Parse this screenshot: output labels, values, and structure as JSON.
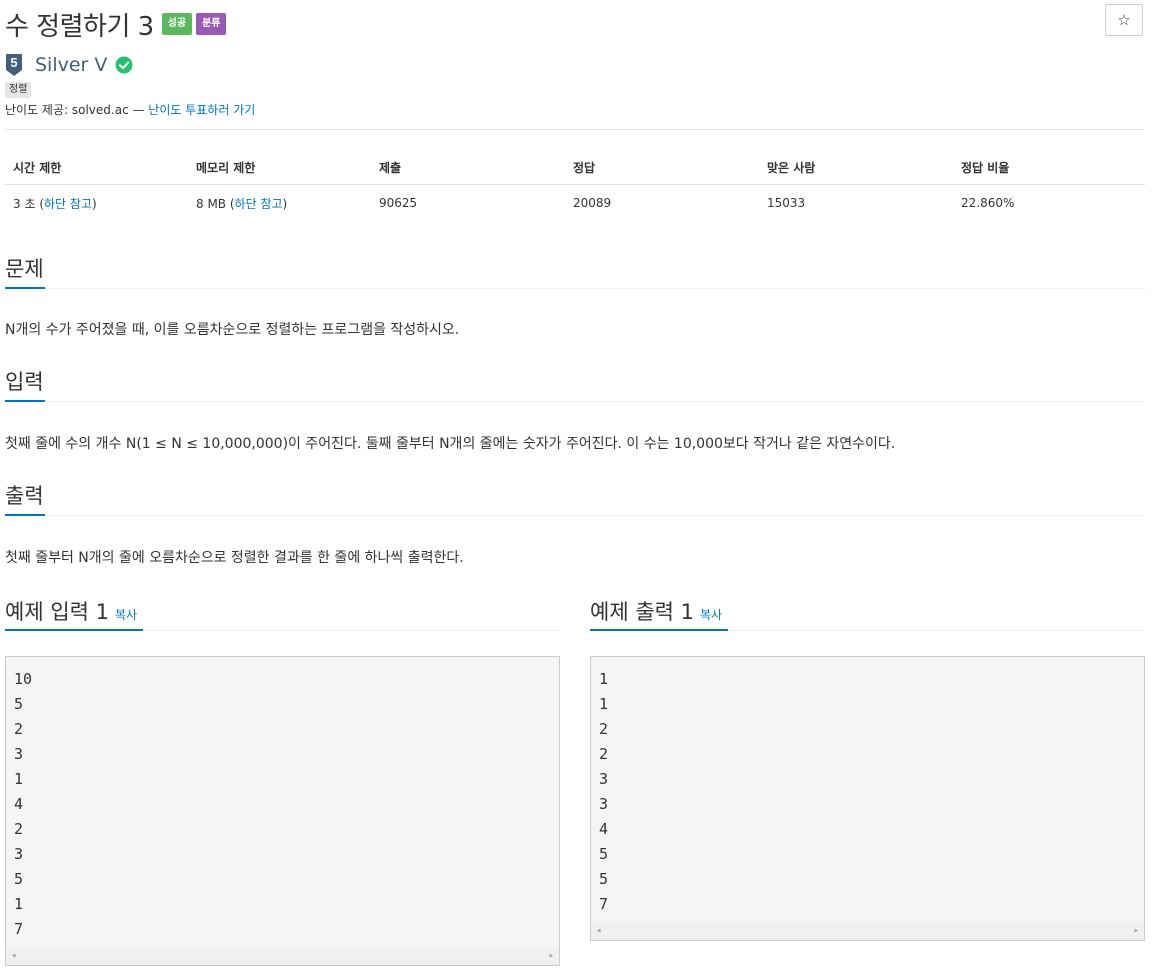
{
  "header": {
    "title": "수 정렬하기 3",
    "badges": [
      "성공",
      "분류"
    ],
    "star_icon": "☆"
  },
  "tier": {
    "name": "Silver V",
    "level": "5"
  },
  "tags": [
    "정렬"
  ],
  "difficulty": {
    "prefix": "난이도 제공: solved.ac — ",
    "vote_link": "난이도 투표하러 가기"
  },
  "info_table": {
    "headers": [
      "시간 제한",
      "메모리 제한",
      "제출",
      "정답",
      "맞은 사람",
      "정답 비율"
    ],
    "time": {
      "value": "3 초",
      "open": " (",
      "link": "하단 참고",
      "close": ")"
    },
    "memory": {
      "value": "8 MB",
      "open": " (",
      "link": "하단 참고",
      "close": ")"
    },
    "submissions": "90625",
    "accepted": "20089",
    "solvers": "15033",
    "ratio": "22.860%"
  },
  "sections": {
    "problem": {
      "title": "문제",
      "text": "N개의 수가 주어졌을 때, 이를 오름차순으로 정렬하는 프로그램을 작성하시오."
    },
    "input": {
      "title": "입력",
      "text": "첫째 줄에 수의 개수 N(1 ≤ N ≤ 10,000,000)이 주어진다. 둘째 줄부터 N개의 줄에는 숫자가 주어진다. 이 수는 10,000보다 작거나 같은 자연수이다."
    },
    "output": {
      "title": "출력",
      "text": "첫째 줄부터 N개의 줄에 오름차순으로 정렬한 결과를 한 줄에 하나씩 출력한다."
    }
  },
  "samples": {
    "input": {
      "title": "예제 입력 1",
      "copy": "복사",
      "lines": [
        "10",
        "5",
        "2",
        "3",
        "1",
        "4",
        "2",
        "3",
        "5",
        "1",
        "7"
      ]
    },
    "output": {
      "title": "예제 출력 1",
      "copy": "복사",
      "lines": [
        "1",
        "1",
        "2",
        "2",
        "3",
        "3",
        "4",
        "5",
        "5",
        "7"
      ]
    }
  },
  "colors": {
    "accent": "#0076c0",
    "success_badge": "#5cb85c",
    "category_badge": "#9b59b6",
    "tier_silver": "#435f7a",
    "check_green": "#27e2a4"
  }
}
